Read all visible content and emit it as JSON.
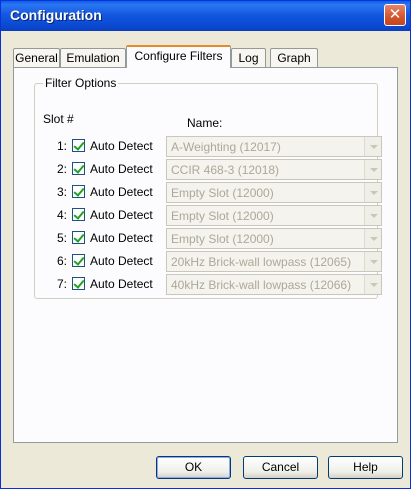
{
  "window": {
    "title": "Configuration",
    "close_glyph": "✕"
  },
  "tabs": [
    {
      "label": "General"
    },
    {
      "label": "Emulation"
    },
    {
      "label": "Configure Filters",
      "active": true
    },
    {
      "label": "Log"
    },
    {
      "label": "Graph"
    }
  ],
  "filter_options": {
    "legend": "Filter Options",
    "slot_header": "Slot #",
    "name_header": "Name:",
    "rows": [
      {
        "slot": "1:",
        "check_label": "Auto Detect",
        "checked": true,
        "value": "A-Weighting (12017)"
      },
      {
        "slot": "2:",
        "check_label": "Auto Detect",
        "checked": true,
        "value": "CCIR 468-3 (12018)"
      },
      {
        "slot": "3:",
        "check_label": "Auto Detect",
        "checked": true,
        "value": "Empty Slot (12000)"
      },
      {
        "slot": "4:",
        "check_label": "Auto Detect",
        "checked": true,
        "value": "Empty Slot (12000)"
      },
      {
        "slot": "5:",
        "check_label": "Auto Detect",
        "checked": true,
        "value": "Empty Slot (12000)"
      },
      {
        "slot": "6:",
        "check_label": "Auto Detect",
        "checked": true,
        "value": "20kHz Brick-wall lowpass (12065)"
      },
      {
        "slot": "7:",
        "check_label": "Auto Detect",
        "checked": true,
        "value": "40kHz Brick-wall lowpass (12066)"
      }
    ]
  },
  "buttons": {
    "ok": "OK",
    "cancel": "Cancel",
    "help": "Help"
  },
  "colors": {
    "title_bar": "#0A48D2",
    "close_button": "#D4542C",
    "active_tab_accent": "#E68B2C",
    "dialog_bg": "#ECE9D8"
  }
}
